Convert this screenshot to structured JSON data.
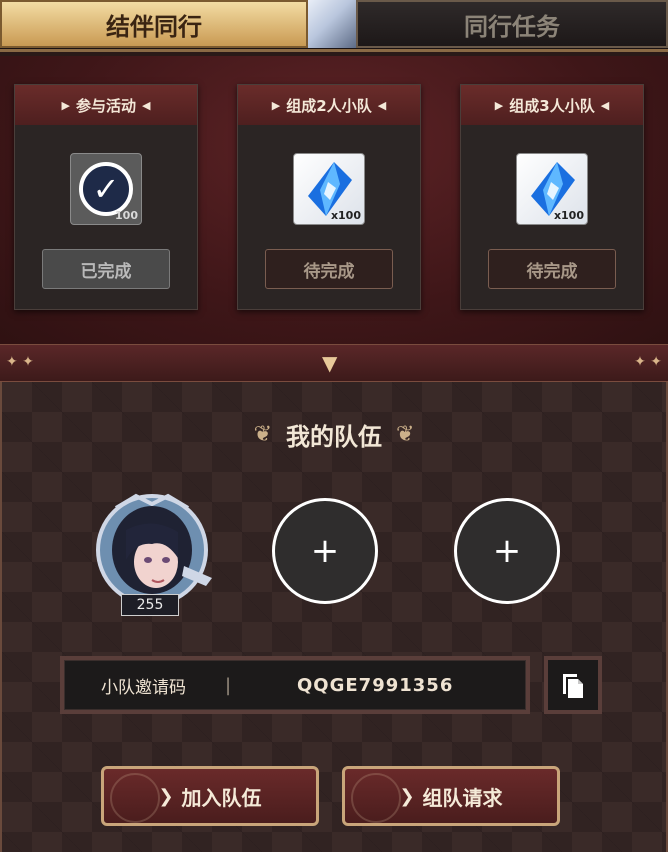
{
  "tabs": {
    "active_label": "结伴同行",
    "inactive_label": "同行任务"
  },
  "tasks": [
    {
      "title": "参与活动",
      "quantity": "100",
      "status": "已完成",
      "icon": "check-badge-icon",
      "done": true
    },
    {
      "title": "组成2人小队",
      "quantity": "x100",
      "status": "待完成",
      "icon": "blue-crystal-icon",
      "done": false
    },
    {
      "title": "组成3人小队",
      "quantity": "x100",
      "status": "待完成",
      "icon": "blue-crystal-icon",
      "done": false
    }
  ],
  "team": {
    "title": "我的队伍",
    "member": {
      "level": "255"
    },
    "empty_slot_symbol": "+"
  },
  "invite": {
    "label": "小队邀请码",
    "separator": "|",
    "code": "QQGE7991356"
  },
  "actions": {
    "join_label": "加入队伍",
    "request_label": "组队请求"
  },
  "colors": {
    "accent_gold": "#c99a53",
    "panel_red": "#5e2326",
    "text_light": "#f1e6d6"
  }
}
